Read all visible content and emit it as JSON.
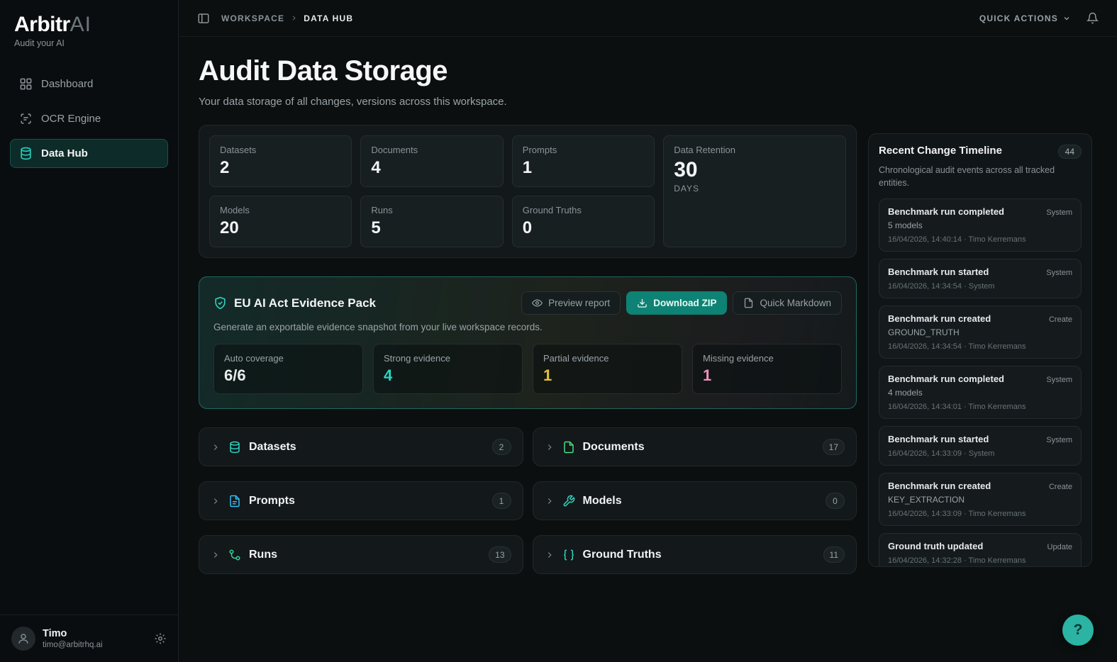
{
  "sidebar": {
    "logo_bold": "Arbitr",
    "logo_light": "AI",
    "tagline": "Audit your AI",
    "items": [
      {
        "label": "Dashboard",
        "active": false
      },
      {
        "label": "OCR Engine",
        "active": false
      },
      {
        "label": "Data Hub",
        "active": true
      }
    ],
    "user": {
      "name": "Timo",
      "email": "timo@arbitrhq.ai"
    }
  },
  "topbar": {
    "breadcrumb": [
      "WORKSPACE",
      "DATA HUB"
    ],
    "quick_actions": "QUICK ACTIONS"
  },
  "header": {
    "title": "Audit Data Storage",
    "subtitle": "Your data storage of all changes, versions across this workspace."
  },
  "stats": [
    {
      "label": "Datasets",
      "value": "2"
    },
    {
      "label": "Documents",
      "value": "4"
    },
    {
      "label": "Prompts",
      "value": "1"
    },
    {
      "label": "Models",
      "value": "20"
    },
    {
      "label": "Runs",
      "value": "5"
    },
    {
      "label": "Ground Truths",
      "value": "0"
    }
  ],
  "retention": {
    "label": "Data Retention",
    "value": "30",
    "unit": "DAYS"
  },
  "evidence_pack": {
    "title": "EU AI Act Evidence Pack",
    "subtitle": "Generate an exportable evidence snapshot from your live workspace records.",
    "buttons": {
      "preview": "Preview report",
      "download": "Download ZIP",
      "markdown": "Quick Markdown"
    },
    "stats": [
      {
        "label": "Auto coverage",
        "value": "6/6",
        "color": "#e9ebec"
      },
      {
        "label": "Strong evidence",
        "value": "4",
        "color": "#2dd4bf"
      },
      {
        "label": "Partial evidence",
        "value": "1",
        "color": "#e3c239"
      },
      {
        "label": "Missing evidence",
        "value": "1",
        "color": "#f090bb"
      }
    ],
    "accent_color": "#2dd4bf"
  },
  "sections": [
    {
      "label": "Datasets",
      "count": "2"
    },
    {
      "label": "Documents",
      "count": "17"
    },
    {
      "label": "Prompts",
      "count": "1"
    },
    {
      "label": "Models",
      "count": "0"
    },
    {
      "label": "Runs",
      "count": "13"
    },
    {
      "label": "Ground Truths",
      "count": "11"
    }
  ],
  "timeline": {
    "title": "Recent Change Timeline",
    "badge": "44",
    "subtitle": "Chronological audit events across all tracked entities.",
    "events": [
      {
        "title": "Benchmark run completed",
        "tag": "System",
        "detail": "5 models",
        "meta": "16/04/2026, 14:40:14 · Timo Kerremans"
      },
      {
        "title": "Benchmark run started",
        "tag": "System",
        "detail": "",
        "meta": "16/04/2026, 14:34:54 · System"
      },
      {
        "title": "Benchmark run created",
        "tag": "Create",
        "detail": "GROUND_TRUTH",
        "meta": "16/04/2026, 14:34:54 · Timo Kerremans"
      },
      {
        "title": "Benchmark run completed",
        "tag": "System",
        "detail": "4 models",
        "meta": "16/04/2026, 14:34:01 · Timo Kerremans"
      },
      {
        "title": "Benchmark run started",
        "tag": "System",
        "detail": "",
        "meta": "16/04/2026, 14:33:09 · System"
      },
      {
        "title": "Benchmark run created",
        "tag": "Create",
        "detail": "KEY_EXTRACTION",
        "meta": "16/04/2026, 14:33:09 · Timo Kerremans"
      },
      {
        "title": "Ground truth updated",
        "tag": "Update",
        "detail": "",
        "meta": "16/04/2026, 14:32:28 · Timo Kerremans"
      }
    ]
  },
  "help": {
    "label": "?"
  }
}
